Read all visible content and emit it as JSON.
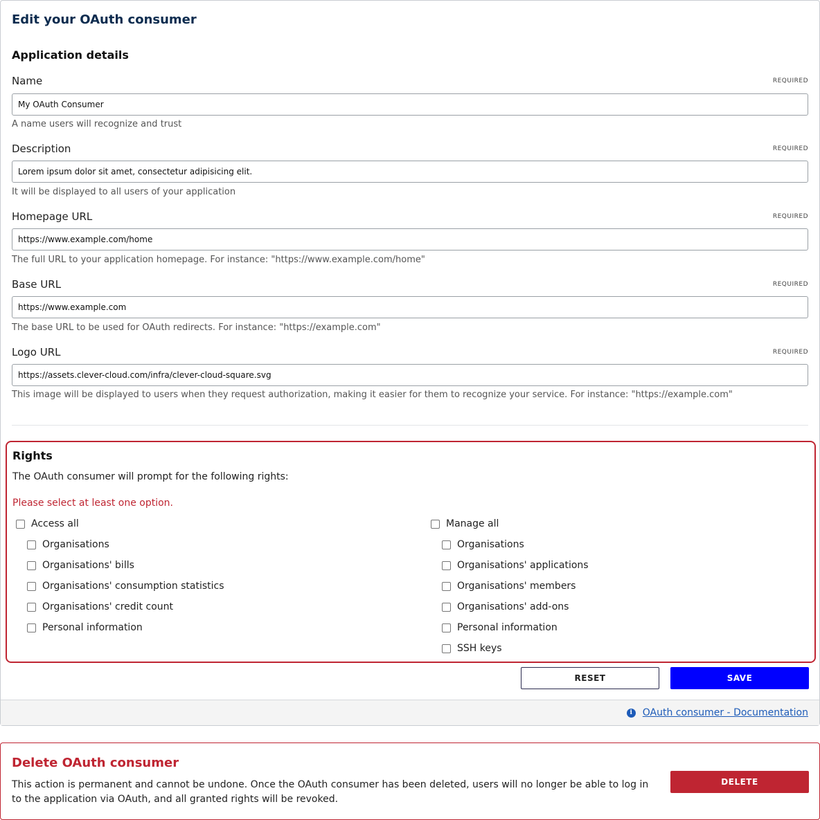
{
  "page": {
    "title": "Edit your OAuth consumer",
    "details_section": "Application details"
  },
  "fields": {
    "name": {
      "label": "Name",
      "required": "REQUIRED",
      "value": "My OAuth Consumer",
      "help": "A name users will recognize and trust"
    },
    "description": {
      "label": "Description",
      "required": "REQUIRED",
      "value": "Lorem ipsum dolor sit amet, consectetur adipisicing elit.",
      "help": "It will be displayed to all users of your application"
    },
    "homepage": {
      "label": "Homepage URL",
      "required": "REQUIRED",
      "value": "https://www.example.com/home",
      "help": "The full URL to your application homepage. For instance: \"https://www.example.com/home\""
    },
    "base": {
      "label": "Base URL",
      "required": "REQUIRED",
      "value": "https://www.example.com",
      "help": "The base URL to be used for OAuth redirects. For instance: \"https://example.com\""
    },
    "logo": {
      "label": "Logo URL",
      "required": "REQUIRED",
      "value": "https://assets.clever-cloud.com/infra/clever-cloud-square.svg",
      "help": "This image will be displayed to users when they request authorization, making it easier for them to recognize your service. For instance: \"https://example.com\""
    }
  },
  "rights": {
    "title": "Rights",
    "intro": "The OAuth consumer will prompt for the following rights:",
    "error": "Please select at least one option.",
    "access": {
      "label": "Access all",
      "items": [
        "Organisations",
        "Organisations' bills",
        "Organisations' consumption statistics",
        "Organisations' credit count",
        "Personal information"
      ]
    },
    "manage": {
      "label": "Manage all",
      "items": [
        "Organisations",
        "Organisations' applications",
        "Organisations' members",
        "Organisations' add-ons",
        "Personal information",
        "SSH keys"
      ]
    }
  },
  "buttons": {
    "reset": "RESET",
    "save": "SAVE",
    "delete": "DELETE"
  },
  "footer": {
    "doc_link": "OAuth consumer - Documentation"
  },
  "delete": {
    "title": "Delete OAuth consumer",
    "text": "This action is permanent and cannot be undone. Once the OAuth consumer has been deleted, users will no longer be able to log in to the application via OAuth, and all granted rights will be revoked."
  },
  "colors": {
    "title": "#0d2c4f",
    "danger": "#bf2532",
    "primary": "#0000ff",
    "link": "#1d5bb8"
  }
}
